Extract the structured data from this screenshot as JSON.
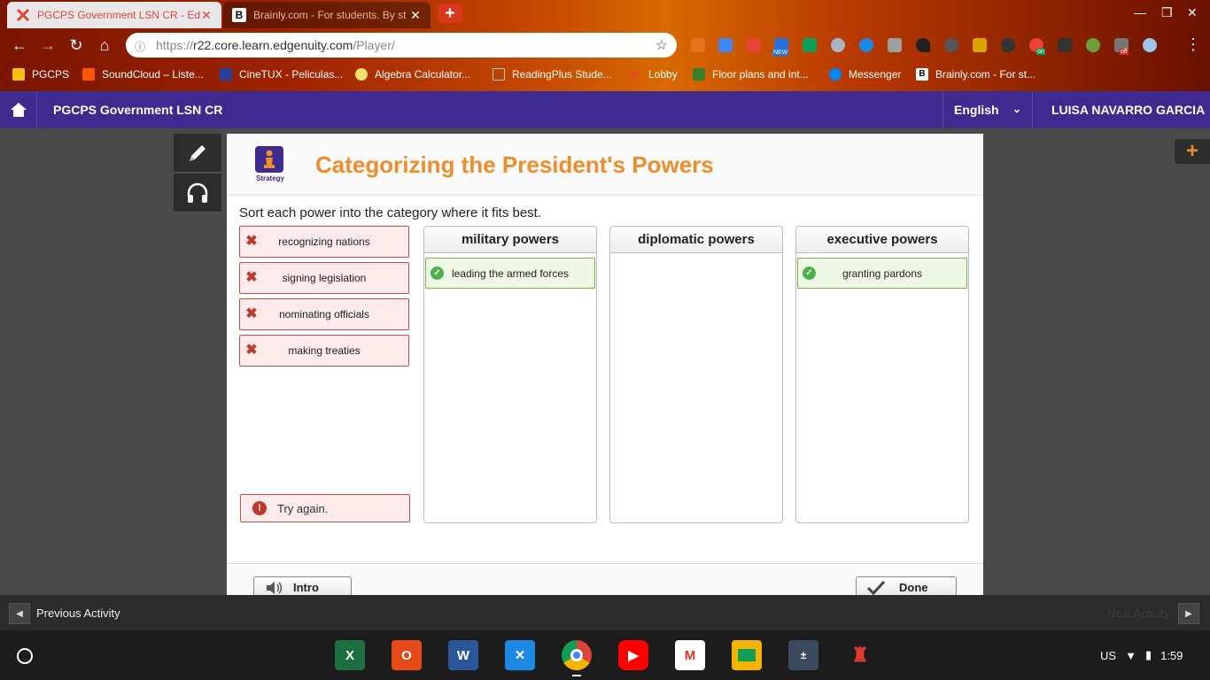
{
  "browser": {
    "tabs": [
      {
        "title": "PGCPS Government LSN CR - Ed",
        "active": true
      },
      {
        "title": "Brainly.com - For students. By st",
        "active": false
      }
    ],
    "url_prefix": "https://",
    "url_host": "r22.core.learn.edgenuity.com",
    "url_path": "/Player/",
    "bookmarks": [
      "PGCPS",
      "SoundCloud – Liste...",
      "CineTUX - Peliculas...",
      "Algebra Calculator...",
      "ReadingPlus Stude...",
      "Lobby",
      "Floor plans and int...",
      "Messenger",
      "Brainly.com - For st..."
    ],
    "extension_badges": {
      "new": "NEW",
      "on": "on",
      "off": "off"
    }
  },
  "header": {
    "course_title": "PGCPS Government LSN CR",
    "language": "English",
    "user_name": "LUISA NAVARRO GARCIA"
  },
  "activity": {
    "strategy_label": "Strategy",
    "title": "Categorizing the President's Powers",
    "instructions": "Sort each power into the category where it fits best.",
    "unsorted_cards": [
      {
        "label": "recognizing nations",
        "status": "incorrect"
      },
      {
        "label": "signing legislation",
        "status": "incorrect"
      },
      {
        "label": "nominating officials",
        "status": "incorrect"
      },
      {
        "label": "making treaties",
        "status": "incorrect"
      }
    ],
    "feedback": "Try again.",
    "categories": [
      {
        "name": "military powers",
        "placed": [
          "leading the armed forces"
        ]
      },
      {
        "name": "diplomatic powers",
        "placed": []
      },
      {
        "name": "executive powers",
        "placed": [
          "granting pardons"
        ]
      }
    ],
    "intro_button": "Intro",
    "done_button": "Done"
  },
  "footer": {
    "previous": "Previous Activity",
    "next": "Next Activity"
  },
  "shelf": {
    "locale": "US",
    "time": "1:59"
  },
  "colors": {
    "brand_purple": "#3f2b8f",
    "title_orange": "#f08d2b",
    "error_red": "#c0504d",
    "correct_green": "#4caf50"
  }
}
